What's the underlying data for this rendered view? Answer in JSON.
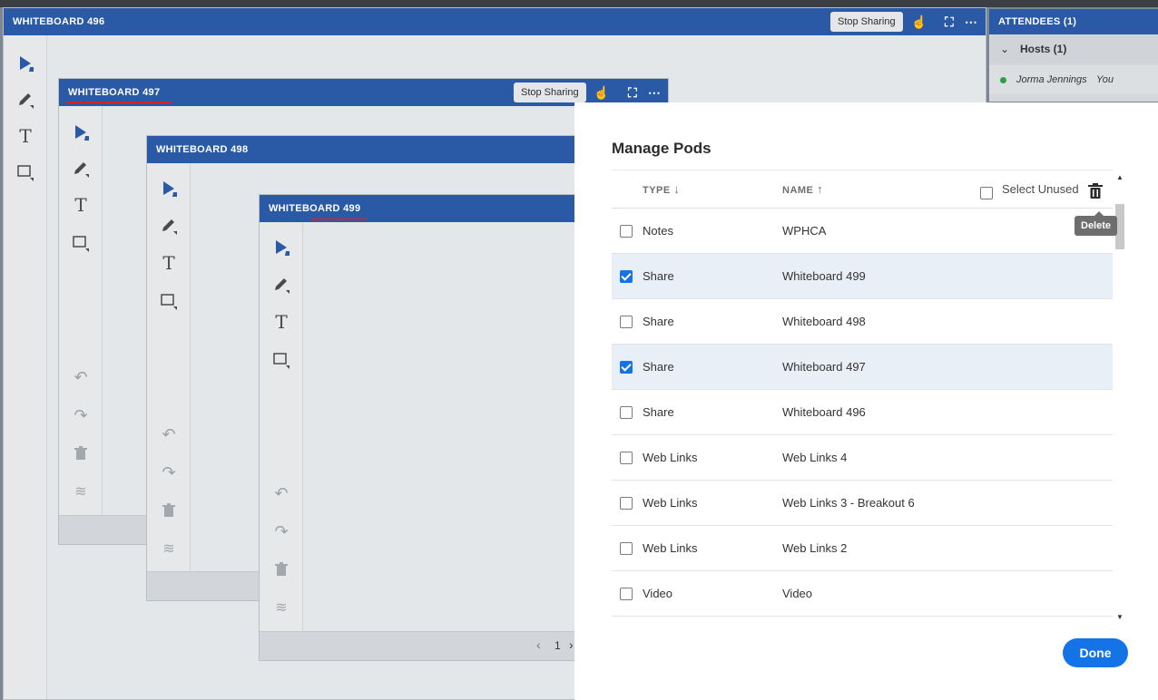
{
  "pods": {
    "wb496": {
      "title": "WHITEBOARD 496",
      "stop_label": "Stop Sharing"
    },
    "wb497": {
      "title": "WHITEBOARD 497",
      "stop_label": "Stop Sharing"
    },
    "wb498": {
      "title": "WHITEBOARD 498"
    },
    "wb499": {
      "title": "WHITEBOARD 499",
      "page_number": "1"
    }
  },
  "attendees": {
    "header": "ATTENDEES  (1)",
    "group_label": "Hosts (1)",
    "member_name": "Jorma Jennings",
    "member_suffix": "You",
    "status_color": "#2ea043"
  },
  "dialog": {
    "title": "Manage Pods",
    "col_type": "TYPE",
    "col_name": "NAME",
    "select_unused_label": "Select Unused",
    "delete_tooltip": "Delete",
    "done_label": "Done",
    "rows": [
      {
        "type": "Notes",
        "name": "WPHCA",
        "checked": false
      },
      {
        "type": "Share",
        "name": "Whiteboard 499",
        "checked": true
      },
      {
        "type": "Share",
        "name": "Whiteboard 498",
        "checked": false
      },
      {
        "type": "Share",
        "name": "Whiteboard 497",
        "checked": true
      },
      {
        "type": "Share",
        "name": "Whiteboard 496",
        "checked": false
      },
      {
        "type": "Web Links",
        "name": "Web Links 4",
        "checked": false
      },
      {
        "type": "Web Links",
        "name": "Web Links 3 - Breakout 6",
        "checked": false
      },
      {
        "type": "Web Links",
        "name": "Web Links 2",
        "checked": false
      },
      {
        "type": "Video",
        "name": "Video",
        "checked": false
      }
    ]
  },
  "colors": {
    "title_bar": "#2a5aa6",
    "accent": "#1473e6",
    "annotation": "#d0242b"
  }
}
